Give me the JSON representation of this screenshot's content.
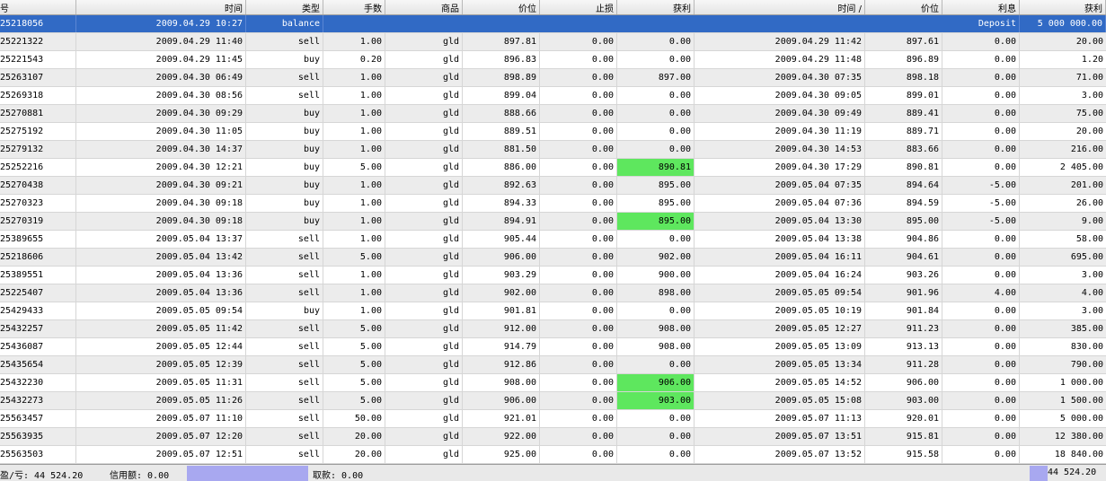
{
  "headers": [
    "号",
    "时间",
    "类型",
    "手数",
    "商品",
    "价位",
    "止损",
    "获利",
    "时间 /",
    "价位",
    "利息",
    "获利"
  ],
  "balance_row": {
    "order": "25218056",
    "time": "2009.04.29 10:27",
    "type": "balance",
    "comment": "Deposit",
    "profit": "5 000 000.00"
  },
  "rows": [
    {
      "order": "25221322",
      "open_time": "2009.04.29 11:40",
      "type": "sell",
      "lots": "1.00",
      "symbol": "gld",
      "open_price": "897.81",
      "sl": "0.00",
      "tp": "0.00",
      "close_time": "2009.04.29 11:42",
      "close_price": "897.61",
      "swap": "0.00",
      "profit": "20.00",
      "tp_highlight": false
    },
    {
      "order": "25221543",
      "open_time": "2009.04.29 11:45",
      "type": "buy",
      "lots": "0.20",
      "symbol": "gld",
      "open_price": "896.83",
      "sl": "0.00",
      "tp": "0.00",
      "close_time": "2009.04.29 11:48",
      "close_price": "896.89",
      "swap": "0.00",
      "profit": "1.20",
      "tp_highlight": false
    },
    {
      "order": "25263107",
      "open_time": "2009.04.30 06:49",
      "type": "sell",
      "lots": "1.00",
      "symbol": "gld",
      "open_price": "898.89",
      "sl": "0.00",
      "tp": "897.00",
      "close_time": "2009.04.30 07:35",
      "close_price": "898.18",
      "swap": "0.00",
      "profit": "71.00",
      "tp_highlight": false
    },
    {
      "order": "25269318",
      "open_time": "2009.04.30 08:56",
      "type": "sell",
      "lots": "1.00",
      "symbol": "gld",
      "open_price": "899.04",
      "sl": "0.00",
      "tp": "0.00",
      "close_time": "2009.04.30 09:05",
      "close_price": "899.01",
      "swap": "0.00",
      "profit": "3.00",
      "tp_highlight": false
    },
    {
      "order": "25270881",
      "open_time": "2009.04.30 09:29",
      "type": "buy",
      "lots": "1.00",
      "symbol": "gld",
      "open_price": "888.66",
      "sl": "0.00",
      "tp": "0.00",
      "close_time": "2009.04.30 09:49",
      "close_price": "889.41",
      "swap": "0.00",
      "profit": "75.00",
      "tp_highlight": false
    },
    {
      "order": "25275192",
      "open_time": "2009.04.30 11:05",
      "type": "buy",
      "lots": "1.00",
      "symbol": "gld",
      "open_price": "889.51",
      "sl": "0.00",
      "tp": "0.00",
      "close_time": "2009.04.30 11:19",
      "close_price": "889.71",
      "swap": "0.00",
      "profit": "20.00",
      "tp_highlight": false
    },
    {
      "order": "25279132",
      "open_time": "2009.04.30 14:37",
      "type": "buy",
      "lots": "1.00",
      "symbol": "gld",
      "open_price": "881.50",
      "sl": "0.00",
      "tp": "0.00",
      "close_time": "2009.04.30 14:53",
      "close_price": "883.66",
      "swap": "0.00",
      "profit": "216.00",
      "tp_highlight": false
    },
    {
      "order": "25252216",
      "open_time": "2009.04.30 12:21",
      "type": "buy",
      "lots": "5.00",
      "symbol": "gld",
      "open_price": "886.00",
      "sl": "0.00",
      "tp": "890.81",
      "close_time": "2009.04.30 17:29",
      "close_price": "890.81",
      "swap": "0.00",
      "profit": "2 405.00",
      "tp_highlight": true
    },
    {
      "order": "25270438",
      "open_time": "2009.04.30 09:21",
      "type": "buy",
      "lots": "1.00",
      "symbol": "gld",
      "open_price": "892.63",
      "sl": "0.00",
      "tp": "895.00",
      "close_time": "2009.05.04 07:35",
      "close_price": "894.64",
      "swap": "-5.00",
      "profit": "201.00",
      "tp_highlight": false
    },
    {
      "order": "25270323",
      "open_time": "2009.04.30 09:18",
      "type": "buy",
      "lots": "1.00",
      "symbol": "gld",
      "open_price": "894.33",
      "sl": "0.00",
      "tp": "895.00",
      "close_time": "2009.05.04 07:36",
      "close_price": "894.59",
      "swap": "-5.00",
      "profit": "26.00",
      "tp_highlight": false
    },
    {
      "order": "25270319",
      "open_time": "2009.04.30 09:18",
      "type": "buy",
      "lots": "1.00",
      "symbol": "gld",
      "open_price": "894.91",
      "sl": "0.00",
      "tp": "895.00",
      "close_time": "2009.05.04 13:30",
      "close_price": "895.00",
      "swap": "-5.00",
      "profit": "9.00",
      "tp_highlight": true
    },
    {
      "order": "25389655",
      "open_time": "2009.05.04 13:37",
      "type": "sell",
      "lots": "1.00",
      "symbol": "gld",
      "open_price": "905.44",
      "sl": "0.00",
      "tp": "0.00",
      "close_time": "2009.05.04 13:38",
      "close_price": "904.86",
      "swap": "0.00",
      "profit": "58.00",
      "tp_highlight": false
    },
    {
      "order": "25218606",
      "open_time": "2009.05.04 13:42",
      "type": "sell",
      "lots": "5.00",
      "symbol": "gld",
      "open_price": "906.00",
      "sl": "0.00",
      "tp": "902.00",
      "close_time": "2009.05.04 16:11",
      "close_price": "904.61",
      "swap": "0.00",
      "profit": "695.00",
      "tp_highlight": false
    },
    {
      "order": "25389551",
      "open_time": "2009.05.04 13:36",
      "type": "sell",
      "lots": "1.00",
      "symbol": "gld",
      "open_price": "903.29",
      "sl": "0.00",
      "tp": "900.00",
      "close_time": "2009.05.04 16:24",
      "close_price": "903.26",
      "swap": "0.00",
      "profit": "3.00",
      "tp_highlight": false
    },
    {
      "order": "25225407",
      "open_time": "2009.05.04 13:36",
      "type": "sell",
      "lots": "1.00",
      "symbol": "gld",
      "open_price": "902.00",
      "sl": "0.00",
      "tp": "898.00",
      "close_time": "2009.05.05 09:54",
      "close_price": "901.96",
      "swap": "4.00",
      "profit": "4.00",
      "tp_highlight": false
    },
    {
      "order": "25429433",
      "open_time": "2009.05.05 09:54",
      "type": "buy",
      "lots": "1.00",
      "symbol": "gld",
      "open_price": "901.81",
      "sl": "0.00",
      "tp": "0.00",
      "close_time": "2009.05.05 10:19",
      "close_price": "901.84",
      "swap": "0.00",
      "profit": "3.00",
      "tp_highlight": false
    },
    {
      "order": "25432257",
      "open_time": "2009.05.05 11:42",
      "type": "sell",
      "lots": "5.00",
      "symbol": "gld",
      "open_price": "912.00",
      "sl": "0.00",
      "tp": "908.00",
      "close_time": "2009.05.05 12:27",
      "close_price": "911.23",
      "swap": "0.00",
      "profit": "385.00",
      "tp_highlight": false
    },
    {
      "order": "25436087",
      "open_time": "2009.05.05 12:44",
      "type": "sell",
      "lots": "5.00",
      "symbol": "gld",
      "open_price": "914.79",
      "sl": "0.00",
      "tp": "908.00",
      "close_time": "2009.05.05 13:09",
      "close_price": "913.13",
      "swap": "0.00",
      "profit": "830.00",
      "tp_highlight": false
    },
    {
      "order": "25435654",
      "open_time": "2009.05.05 12:39",
      "type": "sell",
      "lots": "5.00",
      "symbol": "gld",
      "open_price": "912.86",
      "sl": "0.00",
      "tp": "0.00",
      "close_time": "2009.05.05 13:34",
      "close_price": "911.28",
      "swap": "0.00",
      "profit": "790.00",
      "tp_highlight": false
    },
    {
      "order": "25432230",
      "open_time": "2009.05.05 11:31",
      "type": "sell",
      "lots": "5.00",
      "symbol": "gld",
      "open_price": "908.00",
      "sl": "0.00",
      "tp": "906.00",
      "close_time": "2009.05.05 14:52",
      "close_price": "906.00",
      "swap": "0.00",
      "profit": "1 000.00",
      "tp_highlight": true
    },
    {
      "order": "25432273",
      "open_time": "2009.05.05 11:26",
      "type": "sell",
      "lots": "5.00",
      "symbol": "gld",
      "open_price": "906.00",
      "sl": "0.00",
      "tp": "903.00",
      "close_time": "2009.05.05 15:08",
      "close_price": "903.00",
      "swap": "0.00",
      "profit": "1 500.00",
      "tp_highlight": true
    },
    {
      "order": "25563457",
      "open_time": "2009.05.07 11:10",
      "type": "sell",
      "lots": "50.00",
      "symbol": "gld",
      "open_price": "921.01",
      "sl": "0.00",
      "tp": "0.00",
      "close_time": "2009.05.07 11:13",
      "close_price": "920.01",
      "swap": "0.00",
      "profit": "5 000.00",
      "tp_highlight": false
    },
    {
      "order": "25563935",
      "open_time": "2009.05.07 12:20",
      "type": "sell",
      "lots": "20.00",
      "symbol": "gld",
      "open_price": "922.00",
      "sl": "0.00",
      "tp": "0.00",
      "close_time": "2009.05.07 13:51",
      "close_price": "915.81",
      "swap": "0.00",
      "profit": "12 380.00",
      "tp_highlight": false
    },
    {
      "order": "25563503",
      "open_time": "2009.05.07 12:51",
      "type": "sell",
      "lots": "20.00",
      "symbol": "gld",
      "open_price": "925.00",
      "sl": "0.00",
      "tp": "0.00",
      "close_time": "2009.05.07 13:52",
      "close_price": "915.58",
      "swap": "0.00",
      "profit": "18 840.00",
      "tp_highlight": false
    }
  ],
  "footer": {
    "profit_label": "盈/亏: 44 524.20",
    "credit_label": "信用额: 0.00",
    "withdraw_label": "取款: 0.00",
    "total": "44 524.20"
  },
  "colors": {
    "highlight": "#5ee75e",
    "selected_row": "#316ac5",
    "footer_bar": "#a8a8f0"
  }
}
